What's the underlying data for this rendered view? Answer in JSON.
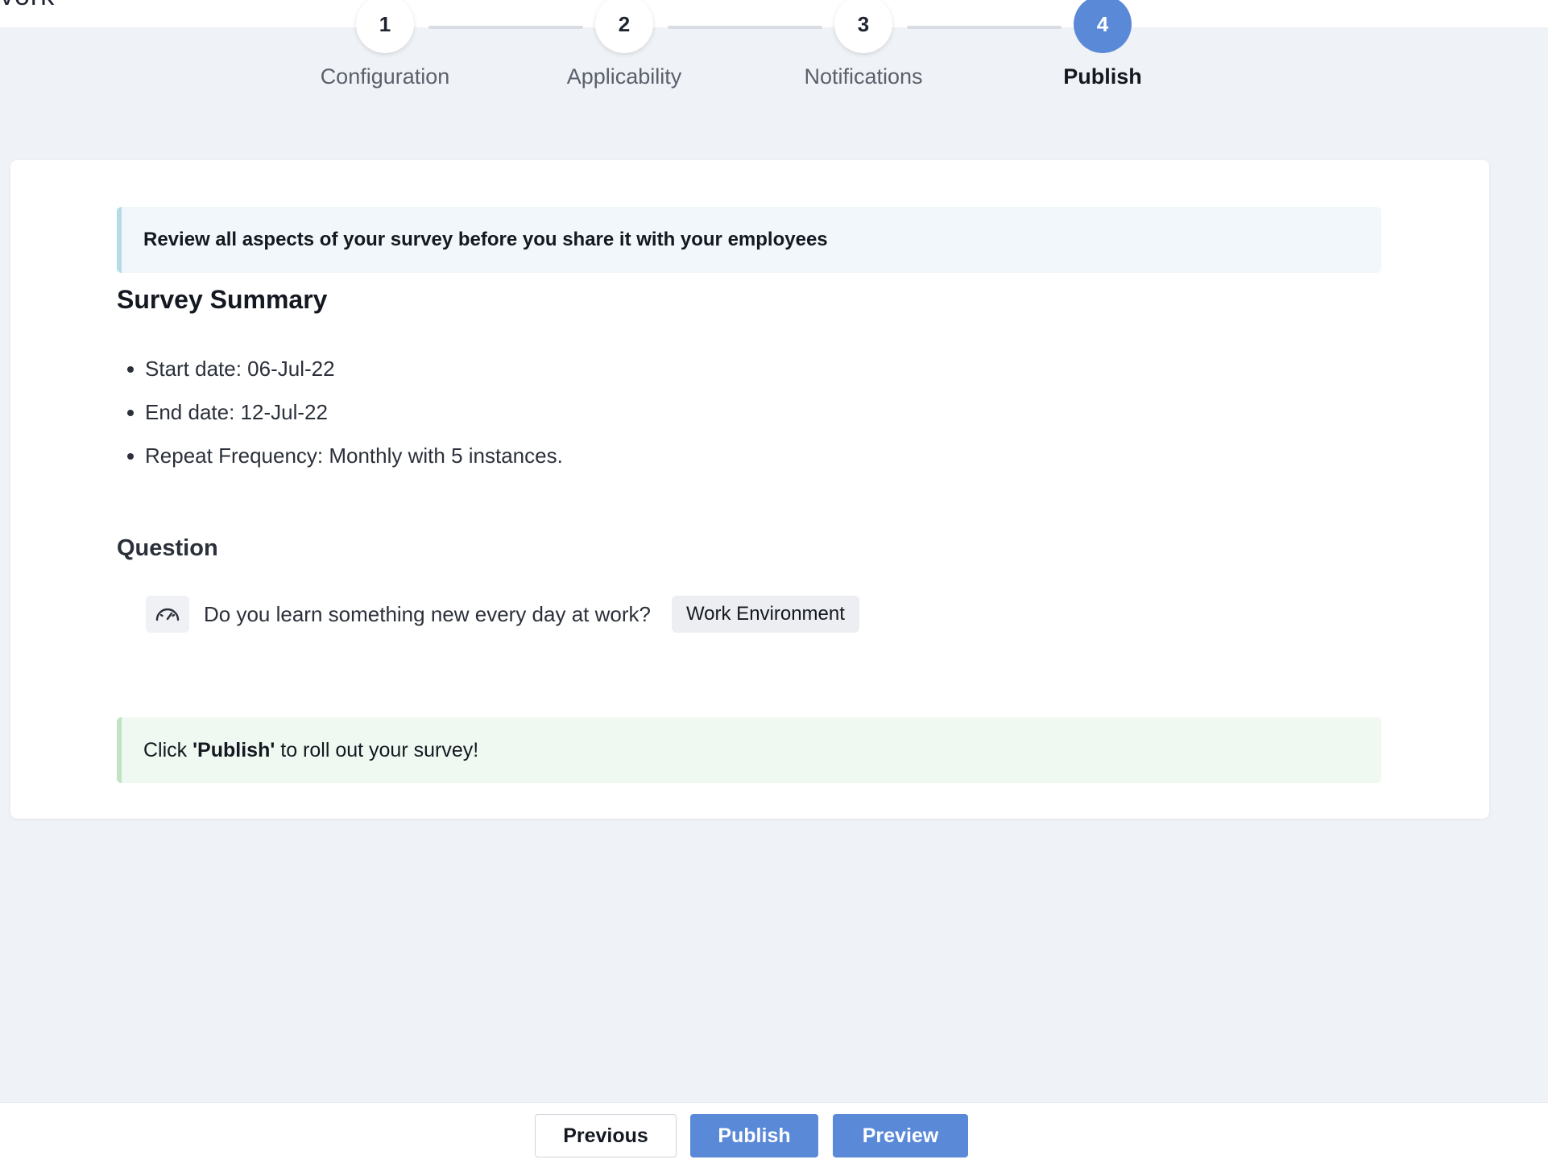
{
  "header": {
    "title_fragment": "vork"
  },
  "stepper": {
    "steps": [
      {
        "number": "1",
        "label": "Configuration"
      },
      {
        "number": "2",
        "label": "Applicability"
      },
      {
        "number": "3",
        "label": "Notifications"
      },
      {
        "number": "4",
        "label": "Publish"
      }
    ],
    "active_step": 4
  },
  "review_banner": {
    "text": "Review all aspects of your survey before you share it with your employees"
  },
  "summary": {
    "title": "Survey Summary",
    "items": [
      "Start date: 06-Jul-22",
      "End date: 12-Jul-22",
      "Repeat Frequency: Monthly with 5 instances."
    ]
  },
  "question_section": {
    "title": "Question",
    "question": {
      "icon": "gauge-icon",
      "text": "Do you learn something new every day at work?",
      "tag": "Work Environment"
    }
  },
  "publish_banner": {
    "prefix": "Click ",
    "emphasis": "'Publish'",
    "suffix": " to roll out your survey!"
  },
  "footer": {
    "previous_label": "Previous",
    "publish_label": "Publish",
    "preview_label": "Preview"
  },
  "colors": {
    "accent": "#5a89d8",
    "page_background": "#eff2f6",
    "info_border": "#b6dbe6",
    "success_border": "#bfe3c3"
  }
}
